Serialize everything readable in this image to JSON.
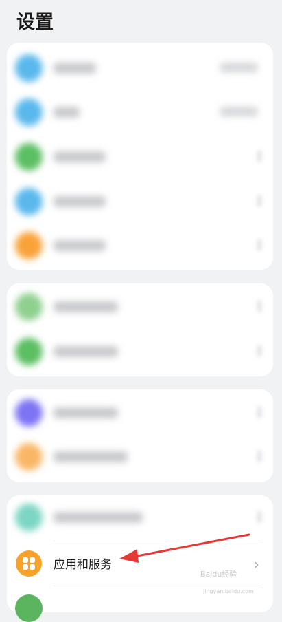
{
  "page": {
    "title": "设置"
  },
  "apps_item": {
    "label": "应用和服务",
    "icon": "apps-grid-icon"
  },
  "watermark": {
    "text": "Baidu经验",
    "sub": "jingyan.baidu.com"
  },
  "colors": {
    "background": "#f1f2f4",
    "card": "#ffffff",
    "apps_icon": "#f7a32b",
    "annotation_arrow": "#e53935"
  }
}
